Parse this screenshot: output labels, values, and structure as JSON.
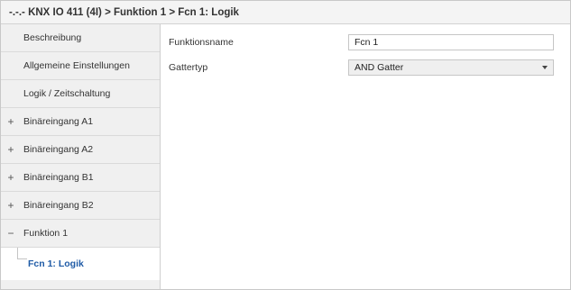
{
  "header": {
    "breadcrumb": "-.-.- KNX IO 411 (4I) > Funktion 1 > Fcn 1: Logik"
  },
  "sidebar": {
    "items": [
      {
        "label": "Beschreibung",
        "toggle": ""
      },
      {
        "label": "Allgemeine Einstellungen",
        "toggle": ""
      },
      {
        "label": "Logik / Zeitschaltung",
        "toggle": ""
      },
      {
        "label": "Binäreingang A1",
        "toggle": "+"
      },
      {
        "label": "Binäreingang A2",
        "toggle": "+"
      },
      {
        "label": "Binäreingang B1",
        "toggle": "+"
      },
      {
        "label": "Binäreingang B2",
        "toggle": "+"
      },
      {
        "label": "Funktion 1",
        "toggle": "−"
      },
      {
        "label": "Fcn 1: Logik",
        "toggle": ""
      }
    ],
    "selected_color": "#1f5ba6"
  },
  "params": {
    "function_name_label": "Funktionsname",
    "function_name_value": "Fcn 1",
    "gate_type_label": "Gattertyp",
    "gate_type_value": "AND Gatter"
  }
}
